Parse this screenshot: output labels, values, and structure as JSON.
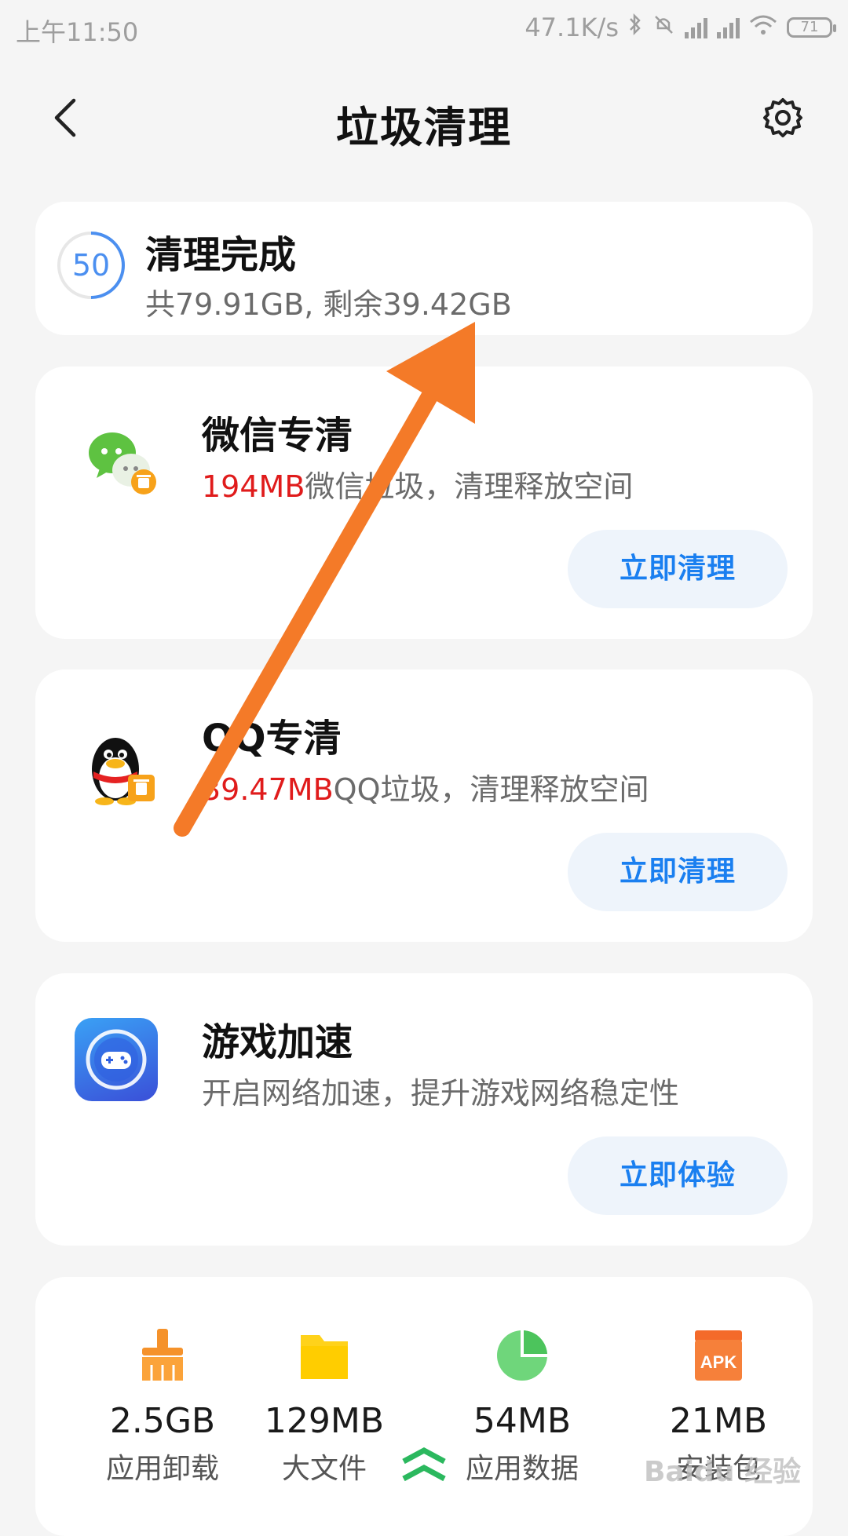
{
  "status_bar": {
    "time": "上午11:50",
    "net_speed": "47.1K/s",
    "battery": "71"
  },
  "header": {
    "title": "垃圾清理"
  },
  "summary": {
    "score": "50",
    "title": "清理完成",
    "subtitle": "共79.91GB, 剩余39.42GB"
  },
  "cards": [
    {
      "title": "微信专清",
      "highlight": "194MB",
      "rest": "微信垃圾，清理释放空间",
      "button": "立即清理"
    },
    {
      "title": "QQ专清",
      "highlight": "39.47MB",
      "rest": "QQ垃圾，清理释放空间",
      "button": "立即清理"
    },
    {
      "title": "游戏加速",
      "highlight": "",
      "rest": "开启网络加速，提升游戏网络稳定性",
      "button": "立即体验"
    }
  ],
  "stats": [
    {
      "value": "2.5GB",
      "label": "应用卸载",
      "icon": "broom-icon"
    },
    {
      "value": "129MB",
      "label": "大文件",
      "icon": "folder-icon"
    },
    {
      "value": "54MB",
      "label": "应用数据",
      "icon": "pie-icon"
    },
    {
      "value": "21MB",
      "label": "安装包",
      "icon": "apk-icon"
    }
  ],
  "apk_icon_text": "APK",
  "watermark": "Baidu 经验",
  "colors": {
    "accent_blue": "#1a7ff0",
    "highlight_red": "#e01b1b",
    "arrow_orange": "#f47a28"
  }
}
